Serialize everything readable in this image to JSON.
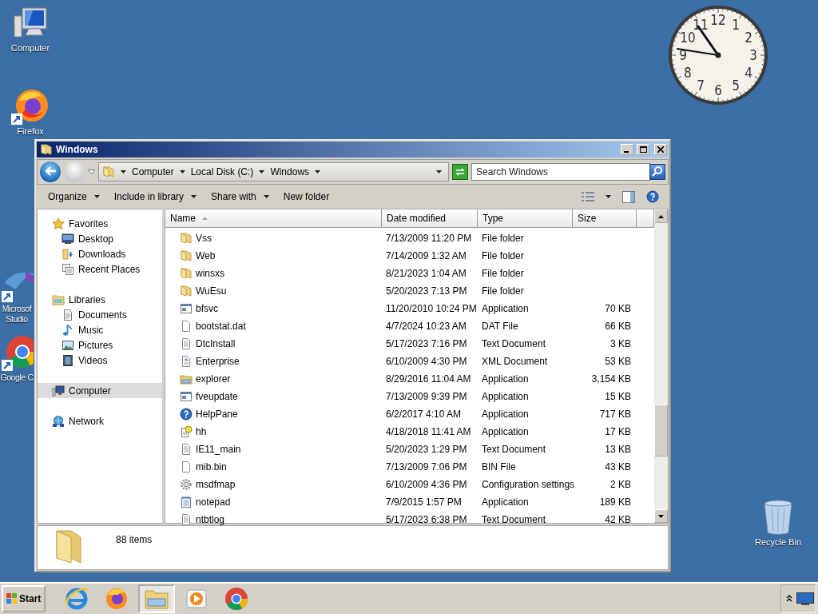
{
  "desktop_icons": [
    {
      "label": "Computer",
      "kind": "computer"
    },
    {
      "label": "Firefox",
      "kind": "firefox"
    },
    {
      "label": "Microsof Studio",
      "kind": "studio"
    },
    {
      "label": "Google C",
      "kind": "chrome"
    },
    {
      "label": "Recycle Bin",
      "kind": "recycle"
    }
  ],
  "clock": {
    "numerals": [
      "12",
      "11",
      "1",
      "10",
      "2",
      "9",
      "3",
      "8",
      "4",
      "7",
      "5",
      "6"
    ]
  },
  "window": {
    "title": "Windows",
    "breadcrumbs": [
      "Computer",
      "Local Disk (C:)",
      "Windows"
    ],
    "search": {
      "placeholder": "Search Windows"
    },
    "toolbar": [
      {
        "label": "Organize",
        "dropdown": true
      },
      {
        "label": "Include in library",
        "dropdown": true
      },
      {
        "label": "Share with",
        "dropdown": true
      },
      {
        "label": "New folder",
        "dropdown": false
      }
    ],
    "sidebar": {
      "items": [
        {
          "label": "Favorites",
          "kind": "favorites",
          "selected": false,
          "children": [
            {
              "label": "Desktop",
              "kind": "desktop",
              "selected": false
            },
            {
              "label": "Downloads",
              "kind": "downloads",
              "selected": false
            },
            {
              "label": "Recent Places",
              "kind": "recent",
              "selected": false
            }
          ]
        },
        {
          "label": "Libraries",
          "kind": "libraries",
          "selected": false,
          "children": [
            {
              "label": "Documents",
              "kind": "documents",
              "selected": false
            },
            {
              "label": "Music",
              "kind": "music",
              "selected": false
            },
            {
              "label": "Pictures",
              "kind": "pictures",
              "selected": false
            },
            {
              "label": "Videos",
              "kind": "videos",
              "selected": false
            }
          ]
        },
        {
          "label": "Computer",
          "kind": "computer",
          "selected": true
        },
        {
          "label": "Network",
          "kind": "network",
          "selected": false
        }
      ]
    },
    "table": {
      "columns": [
        "Name",
        "Date modified",
        "Type",
        "Size"
      ],
      "rows": [
        {
          "kind": "folder",
          "name": "Vss",
          "date": "7/13/2009 11:20 PM",
          "type": "File folder"
        },
        {
          "kind": "folder",
          "name": "Web",
          "date": "7/14/2009 1:32 AM",
          "type": "File folder"
        },
        {
          "kind": "folder",
          "name": "winsxs",
          "date": "8/21/2023 1:04 AM",
          "type": "File folder"
        },
        {
          "kind": "folder",
          "name": "WuEsu",
          "date": "5/20/2023 7:13 PM",
          "type": "File folder"
        },
        {
          "kind": "app",
          "name": "bfsvc",
          "date": "11/20/2010 10:24 PM",
          "type": "Application",
          "size": "70 KB"
        },
        {
          "kind": "file",
          "name": "bootstat.dat",
          "date": "4/7/2024 10:23 AM",
          "type": "DAT File",
          "size": "66 KB"
        },
        {
          "kind": "text",
          "name": "DtcInstall",
          "date": "5/17/2023 7:16 PM",
          "type": "Text Document",
          "size": "3 KB"
        },
        {
          "kind": "xml",
          "name": "Enterprise",
          "date": "6/10/2009 4:30 PM",
          "type": "XML Document",
          "size": "53 KB"
        },
        {
          "kind": "explorer",
          "name": "explorer",
          "date": "8/29/2016 11:04 AM",
          "type": "Application",
          "size": "3,154 KB"
        },
        {
          "kind": "app",
          "name": "fveupdate",
          "date": "7/13/2009 9:39 PM",
          "type": "Application",
          "size": "15 KB"
        },
        {
          "kind": "help",
          "name": "HelpPane",
          "date": "6/2/2017 4:10 AM",
          "type": "Application",
          "size": "717 KB"
        },
        {
          "kind": "helpdoc",
          "name": "hh",
          "date": "4/18/2018 11:41 AM",
          "type": "Application",
          "size": "17 KB"
        },
        {
          "kind": "text",
          "name": "IE11_main",
          "date": "5/20/2023 1:29 PM",
          "type": "Text Document",
          "size": "13 KB"
        },
        {
          "kind": "file",
          "name": "mib.bin",
          "date": "7/13/2009 7:06 PM",
          "type": "BIN File",
          "size": "43 KB"
        },
        {
          "kind": "config",
          "name": "msdfmap",
          "date": "6/10/2009 4:36 PM",
          "type": "Configuration settings",
          "size": "2 KB"
        },
        {
          "kind": "notepad",
          "name": "notepad",
          "date": "7/9/2015 1:57 PM",
          "type": "Application",
          "size": "189 KB"
        },
        {
          "kind": "text",
          "name": "ntbtlog",
          "date": "5/17/2023 6:38 PM",
          "type": "Text Document",
          "size": "42 KB"
        }
      ]
    },
    "status_bar": {
      "text": "88 items"
    }
  },
  "taskbar": {
    "start": "Start",
    "apps": [
      {
        "kind": "ie",
        "selected": false
      },
      {
        "kind": "firefox",
        "selected": false
      },
      {
        "kind": "explorer",
        "selected": true
      },
      {
        "kind": "media",
        "selected": false
      },
      {
        "kind": "chrome",
        "selected": false
      }
    ]
  }
}
